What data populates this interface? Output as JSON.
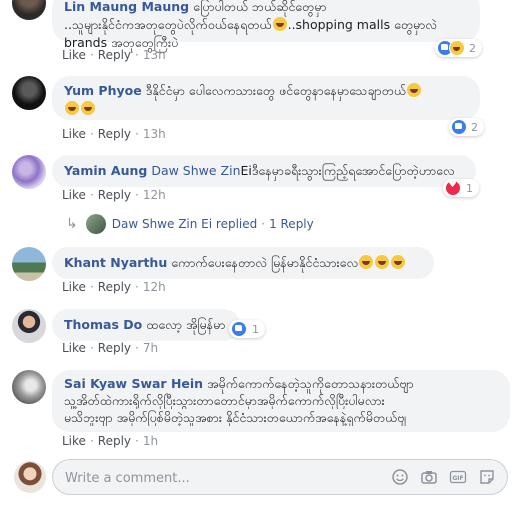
{
  "comments": [
    {
      "author": "Lin Maung Maung",
      "text1": "ပြောပါတယ် ဘယ်ဆိုင်တွေမှာ",
      "text2": "..သူများနိုင်ငံကအတုတွေပဲလိုက်ဝယ်နေရတယ်",
      "text2b": "..shopping malls တွေမှာလဲ",
      "text3": "brands အတုတွေကြီးပဲ",
      "like": "Like",
      "reply": "Reply",
      "time": "13h",
      "reaction_count": "2"
    },
    {
      "author": "Yum Phyoe",
      "text": "ဒီနိုင်ငံမှာ ပေါလေကသားတွေ ဖင်တွေနာနေမှာသေချာတယ်",
      "like": "Like",
      "reply": "Reply",
      "time": "13h",
      "reaction_count": "2"
    },
    {
      "author": "Yamin Aung",
      "tag": "Daw Shwe Zin",
      "text": "Eiဒီနေမှာခရီးသွားကြည့်ရအောင်ပြောတဲ့ဟာလေ",
      "like": "Like",
      "reply": "Reply",
      "time": "12h",
      "reaction_count": "1",
      "reply_summary": {
        "name": "Daw Shwe Zin Ei replied",
        "count": "1 Reply"
      }
    },
    {
      "author": "Khant Nyarthu",
      "text": "ကောက်ပေးနေတာလဲ မြန်မာနိုင်ငံသားလေ",
      "like": "Like",
      "reply": "Reply",
      "time": "12h"
    },
    {
      "author": "Thomas Do",
      "text": "ထလော့ အိုမြန်မာ",
      "like": "Like",
      "reply": "Reply",
      "time": "7h",
      "reaction_count": "1"
    },
    {
      "author": "Sai Kyaw Swar Hein",
      "text1": "အမိုက်ကောက်နေတဲ့သူကိုတောသနားတယ်ဗျာ",
      "text2": "သူ့အိတ်ထဲကားရိုက်လိုပြီးသွားတာတောင်မှာအမိုက်ကောက်လိုပြီးပါမလား",
      "text3": "မသိဘူးဗျာ အမိုက်ပြစ်မိတဲ့သူအစား နိုင်ငံသားတယောက်အနေနဲ့ရှက်မိတယ်ဗျ",
      "like": "Like",
      "reply": "Reply",
      "time": "1h"
    }
  ],
  "composer": {
    "placeholder": "Write a comment..."
  },
  "icons": {
    "emoji": "emoji-icon",
    "camera": "camera-icon",
    "gif": "gif-icon",
    "sticker": "sticker-icon"
  },
  "colors": {
    "author": "#385898",
    "bubble": "#f2f3f5",
    "meta": "#90949c",
    "like_blue": "#3b7dea"
  }
}
